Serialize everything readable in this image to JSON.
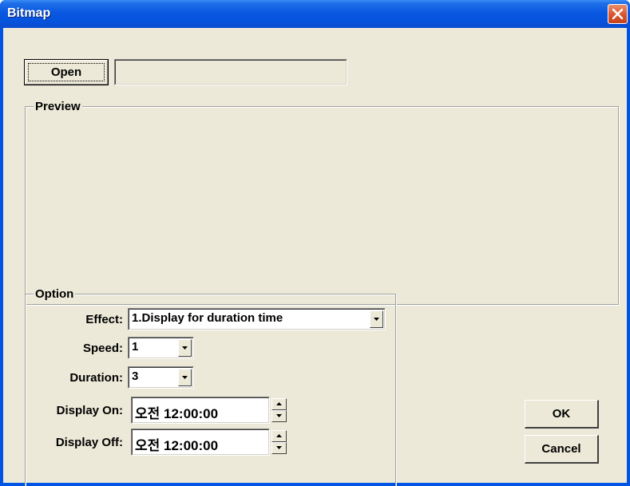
{
  "window": {
    "title": "Bitmap"
  },
  "toolbar": {
    "open_label": "Open",
    "file_path": ""
  },
  "preview": {
    "label": "Preview"
  },
  "option": {
    "label": "Option",
    "effect_label": "Effect:",
    "effect_value": "1.Display for duration time",
    "speed_label": "Speed:",
    "speed_value": "1",
    "duration_label": "Duration:",
    "duration_value": "3",
    "display_on_label": "Display On:",
    "display_on_value": "오전 12:00:00",
    "display_off_label": "Display Off:",
    "display_off_value": "오전 12:00:00"
  },
  "buttons": {
    "ok_label": "OK",
    "cancel_label": "Cancel"
  },
  "icons": {
    "close": "close-icon",
    "dropdown": "chevron-down-icon",
    "spin_up": "arrow-up-icon",
    "spin_down": "arrow-down-icon"
  },
  "colors": {
    "title_bar": "#0a58e0",
    "close_button": "#d9532f",
    "dialog_bg": "#ece9d8"
  }
}
